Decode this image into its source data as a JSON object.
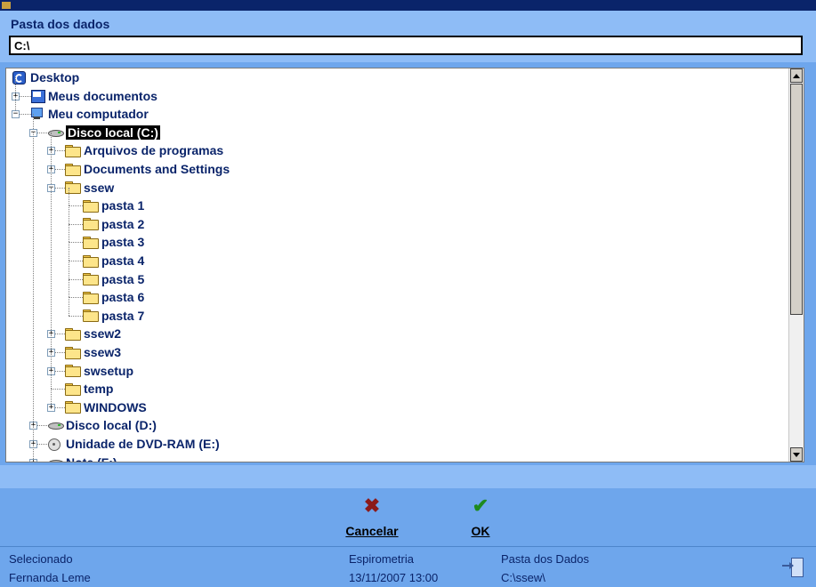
{
  "header": {
    "title": "Pasta dos dados",
    "path_value": "C:\\"
  },
  "tree": {
    "nodes": [
      {
        "label": "Desktop",
        "icon": "desktop-icon",
        "expander": "none",
        "selected": false
      },
      {
        "label": "Meus documentos",
        "icon": "my-documents-icon",
        "expander": "plus",
        "selected": false
      },
      {
        "label": "Meu computador",
        "icon": "my-computer-icon",
        "expander": "minus",
        "selected": false
      },
      {
        "label": "Disco local (C:)",
        "icon": "drive-icon",
        "expander": "minus",
        "selected": true
      },
      {
        "label": "Arquivos de programas",
        "icon": "folder-icon",
        "expander": "plus",
        "selected": false
      },
      {
        "label": "Documents and Settings",
        "icon": "folder-icon",
        "expander": "plus",
        "selected": false
      },
      {
        "label": "ssew",
        "icon": "folder-icon",
        "expander": "minus",
        "selected": false
      },
      {
        "label": "pasta 1",
        "icon": "folder-icon",
        "expander": "none",
        "selected": false
      },
      {
        "label": "pasta 2",
        "icon": "folder-icon",
        "expander": "none",
        "selected": false
      },
      {
        "label": "pasta 3",
        "icon": "folder-icon",
        "expander": "none",
        "selected": false
      },
      {
        "label": "pasta 4",
        "icon": "folder-icon",
        "expander": "none",
        "selected": false
      },
      {
        "label": "pasta 5",
        "icon": "folder-icon",
        "expander": "none",
        "selected": false
      },
      {
        "label": "pasta 6",
        "icon": "folder-icon",
        "expander": "none",
        "selected": false
      },
      {
        "label": "pasta 7",
        "icon": "folder-icon",
        "expander": "none",
        "selected": false
      },
      {
        "label": "ssew2",
        "icon": "folder-icon",
        "expander": "plus",
        "selected": false
      },
      {
        "label": "ssew3",
        "icon": "folder-icon",
        "expander": "plus",
        "selected": false
      },
      {
        "label": "swsetup",
        "icon": "folder-icon",
        "expander": "plus",
        "selected": false
      },
      {
        "label": "temp",
        "icon": "folder-icon",
        "expander": "none",
        "selected": false
      },
      {
        "label": "WINDOWS",
        "icon": "folder-icon",
        "expander": "plus",
        "selected": false
      },
      {
        "label": "Disco local (D:)",
        "icon": "drive-icon",
        "expander": "plus",
        "selected": false
      },
      {
        "label": "Unidade de DVD-RAM (E:)",
        "icon": "dvd-drive-icon",
        "expander": "plus",
        "selected": false
      },
      {
        "label": "Note (F:)",
        "icon": "drive-icon",
        "expander": "plus",
        "selected": false
      }
    ]
  },
  "actions": {
    "cancel_label": "Cancelar",
    "cancel_icon": "x-mark-icon",
    "ok_label": "OK",
    "ok_icon": "checkmark-icon"
  },
  "status": {
    "selected_label": "Selecionado",
    "selected_value": "Fernanda Leme",
    "exam_label": "Espirometria",
    "exam_datetime": "13/11/2007 13:00",
    "folder_label": "Pasta dos Dados",
    "folder_value": "C:\\ssew\\"
  },
  "colors": {
    "background": "#6EA6EC",
    "header": "#8EBCF6",
    "text_dark": "#0A246A",
    "cancel_icon": "#8B1A1A",
    "ok_icon": "#1E8A1E"
  }
}
